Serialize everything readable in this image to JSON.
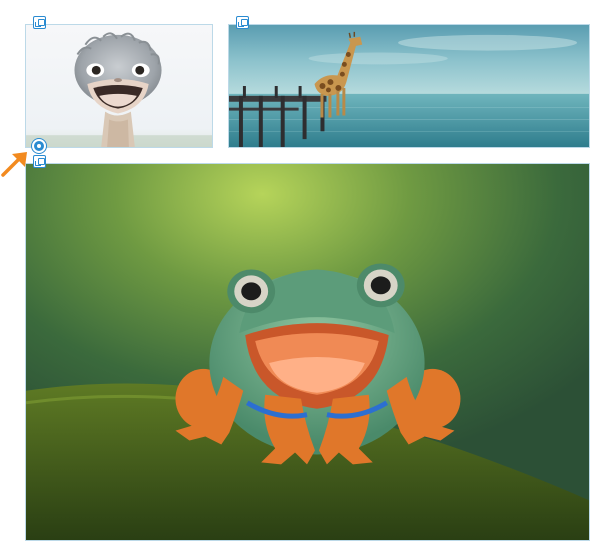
{
  "images": [
    {
      "name": "ostrich",
      "subject": "ostrich-photo"
    },
    {
      "name": "giraffe",
      "subject": "giraffe-on-pier-photo"
    },
    {
      "name": "frog",
      "subject": "tree-frog-photo"
    }
  ],
  "icons": {
    "badge": "image-position-icon",
    "handle": "anchor-icon",
    "pointer": "arrow-pointer-icon"
  },
  "colors": {
    "selection": "#2a8bd1",
    "pointer": "#f28a1f"
  }
}
